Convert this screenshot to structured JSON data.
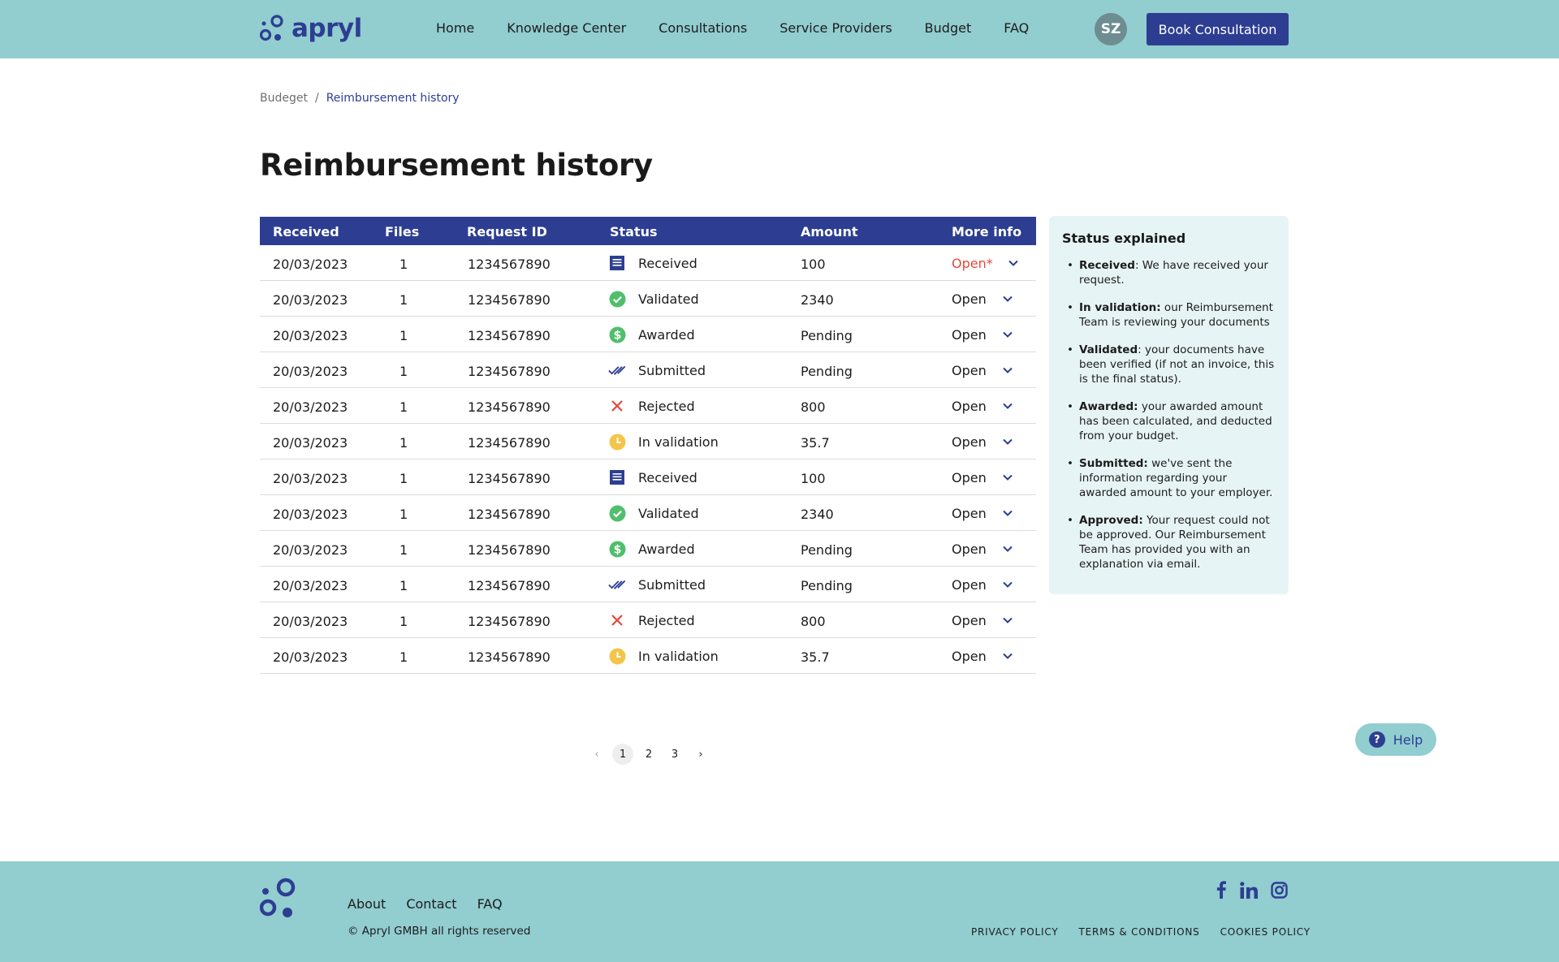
{
  "header": {
    "logo_text": "apryl",
    "nav": [
      {
        "label": "Home"
      },
      {
        "label": "Knowledge Center"
      },
      {
        "label": "Consultations"
      },
      {
        "label": "Service Providers"
      },
      {
        "label": "Budget"
      },
      {
        "label": "FAQ"
      }
    ],
    "avatar_initials": "SZ",
    "book_label": "Book Consultation"
  },
  "breadcrumb": {
    "parent": "Budeget",
    "separator": "/",
    "current": "Reimbursement history"
  },
  "page_title": "Reimbursement history",
  "table": {
    "headers": {
      "received": "Received",
      "files": "Files",
      "request_id": "Request ID",
      "status": "Status",
      "amount": "Amount",
      "more": "More info"
    },
    "rows": [
      {
        "received": "20/03/2023",
        "files": "1",
        "request_id": "1234567890",
        "status": "Received",
        "status_icon": "document-list-icon",
        "amount": "100",
        "more": "Open*",
        "highlight": true
      },
      {
        "received": "20/03/2023",
        "files": "1",
        "request_id": "1234567890",
        "status": "Validated",
        "status_icon": "check-circle-icon",
        "amount": "2340",
        "more": "Open"
      },
      {
        "received": "20/03/2023",
        "files": "1",
        "request_id": "1234567890",
        "status": "Awarded",
        "status_icon": "dollar-circle-icon",
        "amount": "Pending",
        "more": "Open"
      },
      {
        "received": "20/03/2023",
        "files": "1",
        "request_id": "1234567890",
        "status": "Submitted",
        "status_icon": "double-check-icon",
        "amount": "Pending",
        "more": "Open"
      },
      {
        "received": "20/03/2023",
        "files": "1",
        "request_id": "1234567890",
        "status": "Rejected",
        "status_icon": "cross-icon",
        "amount": "800",
        "more": "Open"
      },
      {
        "received": "20/03/2023",
        "files": "1",
        "request_id": "1234567890",
        "status": "In validation",
        "status_icon": "clock-icon",
        "amount": "35.7",
        "more": "Open"
      },
      {
        "received": "20/03/2023",
        "files": "1",
        "request_id": "1234567890",
        "status": "Received",
        "status_icon": "document-list-icon",
        "amount": "100",
        "more": "Open"
      },
      {
        "received": "20/03/2023",
        "files": "1",
        "request_id": "1234567890",
        "status": "Validated",
        "status_icon": "check-circle-icon",
        "amount": "2340",
        "more": "Open"
      },
      {
        "received": "20/03/2023",
        "files": "1",
        "request_id": "1234567890",
        "status": "Awarded",
        "status_icon": "dollar-circle-icon",
        "amount": "Pending",
        "more": "Open"
      },
      {
        "received": "20/03/2023",
        "files": "1",
        "request_id": "1234567890",
        "status": "Submitted",
        "status_icon": "double-check-icon",
        "amount": "Pending",
        "more": "Open"
      },
      {
        "received": "20/03/2023",
        "files": "1",
        "request_id": "1234567890",
        "status": "Rejected",
        "status_icon": "cross-icon",
        "amount": "800",
        "more": "Open"
      },
      {
        "received": "20/03/2023",
        "files": "1",
        "request_id": "1234567890",
        "status": "In validation",
        "status_icon": "clock-icon",
        "amount": "35.7",
        "more": "Open"
      }
    ]
  },
  "status_panel": {
    "title": "Status explained",
    "items": [
      {
        "term": "Received",
        "text": ": We have received your request."
      },
      {
        "term": "In validation:",
        "text": " our Reimbursement Team is reviewing your documents"
      },
      {
        "term": "Validated",
        "text": ": your documents have been verified (if not an invoice, this is the final status)."
      },
      {
        "term": "Awarded:",
        "text": " your awarded amount has been calculated, and deducted from your budget."
      },
      {
        "term": "Submitted:",
        "text": " we've sent the information regarding your awarded amount to your employer."
      },
      {
        "term": "Approved:",
        "text": " Your request could not be approved. Our Reimbursement Team has provided you with an explanation via email."
      }
    ]
  },
  "pagination": {
    "prev": "‹",
    "pages": [
      "1",
      "2",
      "3"
    ],
    "next": "›",
    "current": "1"
  },
  "help": {
    "icon": "?",
    "label": "Help"
  },
  "footer": {
    "links": [
      {
        "label": "About"
      },
      {
        "label": "Contact"
      },
      {
        "label": "FAQ"
      }
    ],
    "copyright": "© Apryl GMBH all rights reserved",
    "social": [
      "facebook-icon",
      "linkedin-icon",
      "instagram-icon"
    ],
    "legal": [
      {
        "label": "PRIVACY POLICY"
      },
      {
        "label": "TERMS & CONDITIONS"
      },
      {
        "label": "COOKIES POLICY"
      }
    ]
  },
  "colors": {
    "primary": "#2d3e92",
    "header_bg": "#92cdd0",
    "panel_bg": "#e7f4f5",
    "alert": "#e5483c",
    "success": "#4fbf6b",
    "warning": "#f3c54a"
  }
}
